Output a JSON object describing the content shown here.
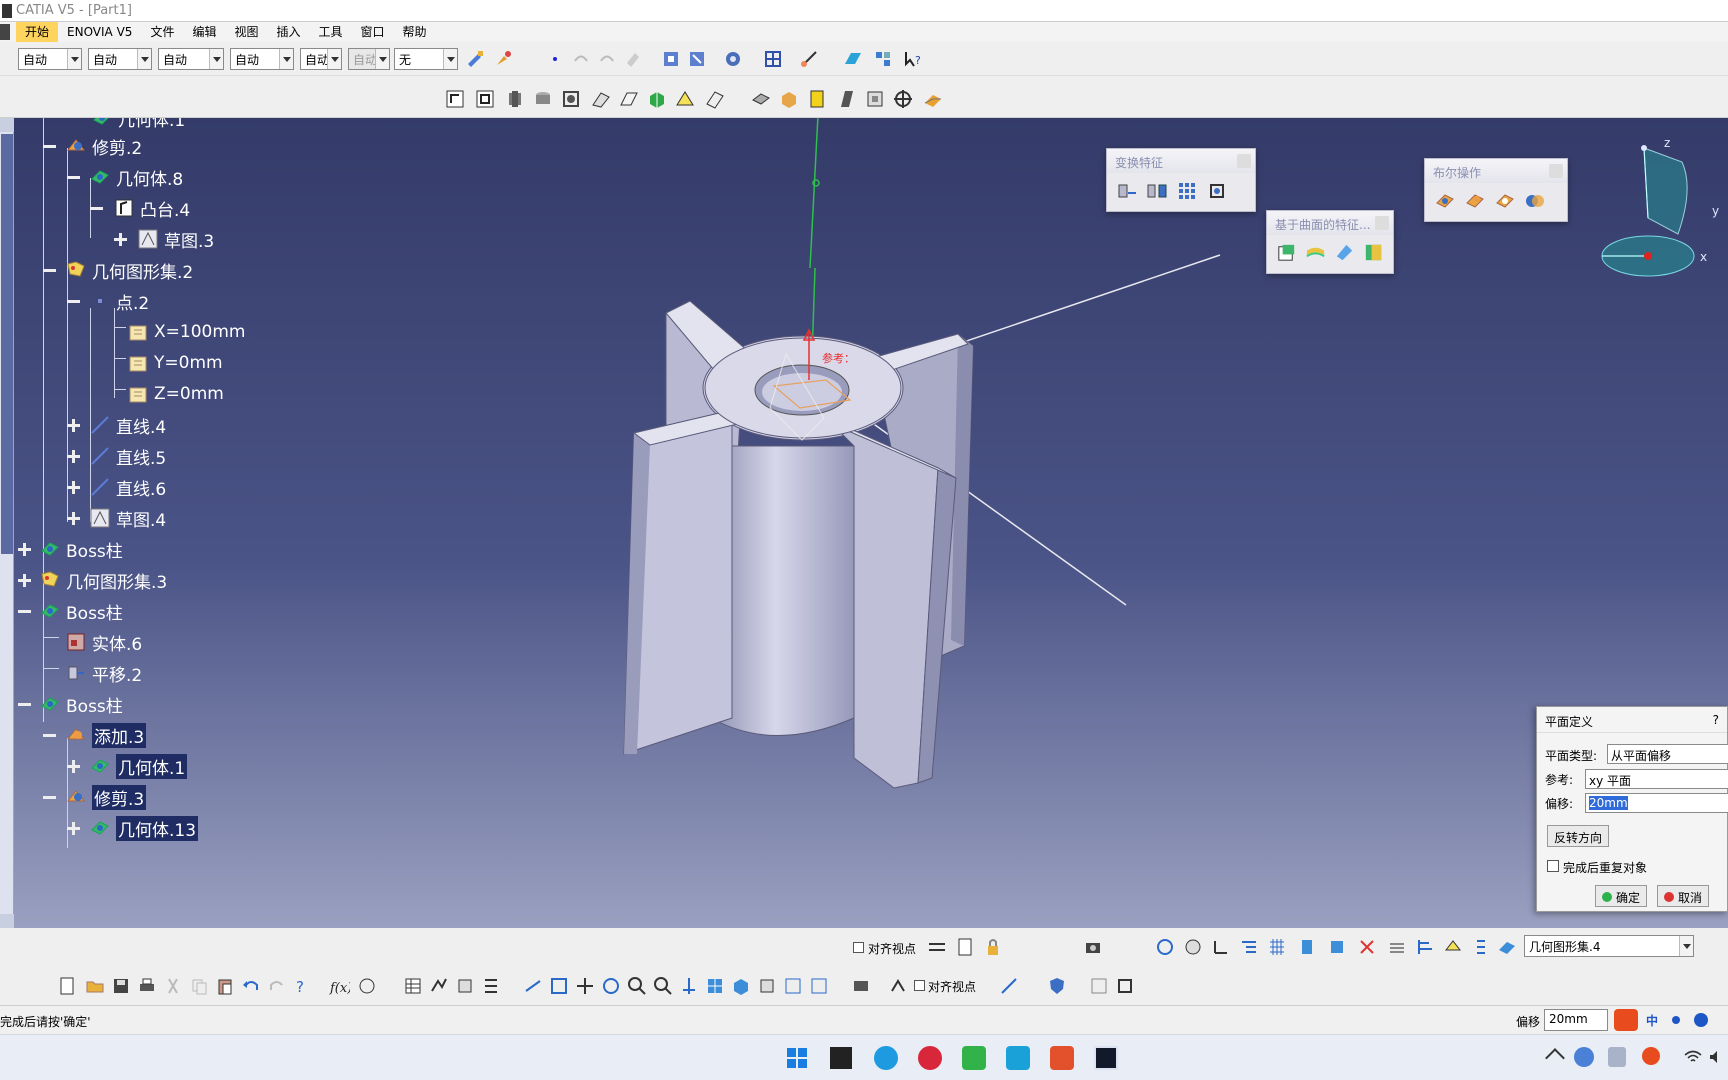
{
  "window": {
    "title": "CATIA V5 - [Part1]"
  },
  "menu": {
    "items": [
      "开始",
      "ENOVIA V5",
      "文件",
      "编辑",
      "视图",
      "插入",
      "工具",
      "窗口",
      "帮助"
    ]
  },
  "toolbar": {
    "combos": [
      "自动",
      "自动",
      "自动",
      "自动",
      "自动",
      "自动",
      "无"
    ]
  },
  "tree": {
    "nodes": [
      {
        "label": "几何体.1",
        "icon": "body-icon"
      },
      {
        "label": "修剪.2",
        "icon": "trim-icon"
      },
      {
        "label": "几何体.8",
        "icon": "body-icon"
      },
      {
        "label": "凸台.4",
        "icon": "pad-icon"
      },
      {
        "label": "草图.3",
        "icon": "sketch-icon"
      },
      {
        "label": "几何图形集.2",
        "icon": "geometrical-set-icon"
      },
      {
        "label": "点.2",
        "icon": "point-icon"
      },
      {
        "label": "X=100mm",
        "icon": "parameter-icon"
      },
      {
        "label": "Y=0mm",
        "icon": "parameter-icon"
      },
      {
        "label": "Z=0mm",
        "icon": "parameter-icon"
      },
      {
        "label": "直线.4",
        "icon": "line-icon"
      },
      {
        "label": "直线.5",
        "icon": "line-icon"
      },
      {
        "label": "直线.6",
        "icon": "line-icon"
      },
      {
        "label": "草图.4",
        "icon": "sketch-icon"
      },
      {
        "label": "Boss柱",
        "icon": "body-icon"
      },
      {
        "label": "几何图形集.3",
        "icon": "geometrical-set-icon"
      },
      {
        "label": "Boss柱",
        "icon": "body-icon"
      },
      {
        "label": "实体.6",
        "icon": "solid-icon"
      },
      {
        "label": "平移.2",
        "icon": "translate-icon"
      },
      {
        "label": "Boss柱",
        "icon": "body-icon"
      },
      {
        "label": "添加.3",
        "icon": "add-icon"
      },
      {
        "label": "几何体.1",
        "icon": "body-icon"
      },
      {
        "label": "修剪.3",
        "icon": "trim-icon"
      },
      {
        "label": "几何体.13",
        "icon": "body-icon"
      }
    ]
  },
  "floating_toolbars": {
    "transform": {
      "title": "变换特征"
    },
    "surface_based": {
      "title": "基于曲面的特征..."
    },
    "boolean": {
      "title": "布尔操作"
    }
  },
  "viewport": {
    "reference_label": "参考：",
    "axis_label": "Z",
    "compass": {
      "z": "z",
      "y": "y",
      "x": "x"
    }
  },
  "plane_dialog": {
    "title": "平面定义",
    "help": "?",
    "type_label": "平面类型:",
    "type_value": "从平面偏移",
    "ref_label": "参考:",
    "ref_value": "xy 平面",
    "offset_label": "偏移:",
    "offset_value": "20mm",
    "reverse_button": "反转方向",
    "repeat_checkbox": "完成后重复对象",
    "ok_button": "确定",
    "cancel_button": "取消"
  },
  "bottom": {
    "align_view_1": "对齐视点",
    "align_view_2": "对齐视点",
    "current_set": "几何图形集.4"
  },
  "status": {
    "prompt": "完成后请按'确定'",
    "offset_label": "偏移",
    "offset_value": "20mm",
    "ime": "中"
  },
  "colors": {
    "viewport_top": "#343b69",
    "viewport_bottom": "#9aa0c0",
    "part_face": "#c9c9e0",
    "selection": "#2f6bd9"
  }
}
